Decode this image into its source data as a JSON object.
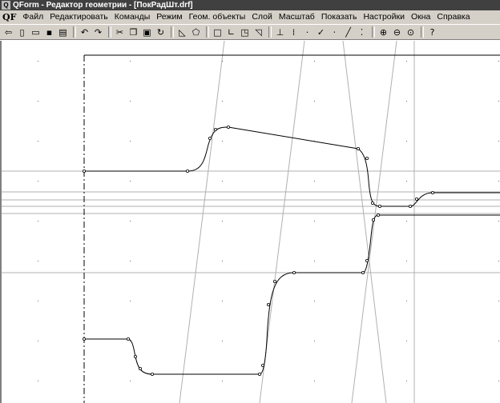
{
  "window": {
    "title": "QForm - Редактор геометрии  - [ПокРадШт.drf]",
    "app_logo": "QF"
  },
  "menu": {
    "items": [
      "Файл",
      "Редактировать",
      "Команды",
      "Режим",
      "Геом. объекты",
      "Слой",
      "Масштаб",
      "Показать",
      "Настройки",
      "Окна",
      "Справка"
    ]
  },
  "toolbar": {
    "buttons": [
      "exit-icon",
      "new-file-icon",
      "open-file-icon",
      "save-icon",
      "print-icon",
      "undo-icon",
      "redo-icon",
      "cut-icon",
      "copy-icon",
      "paste-icon",
      "refresh-icon",
      "polyline-icon",
      "polygon-icon",
      "rectangle-icon",
      "corner-icon",
      "offset-icon",
      "trim-icon",
      "axis-icon",
      "grid-snap-icon",
      "point-icon",
      "check-icon",
      "node-icon",
      "line-icon",
      "dots-icon",
      "zoom-in-icon",
      "zoom-out-icon",
      "zoom-fit-icon",
      "help-icon"
    ]
  }
}
